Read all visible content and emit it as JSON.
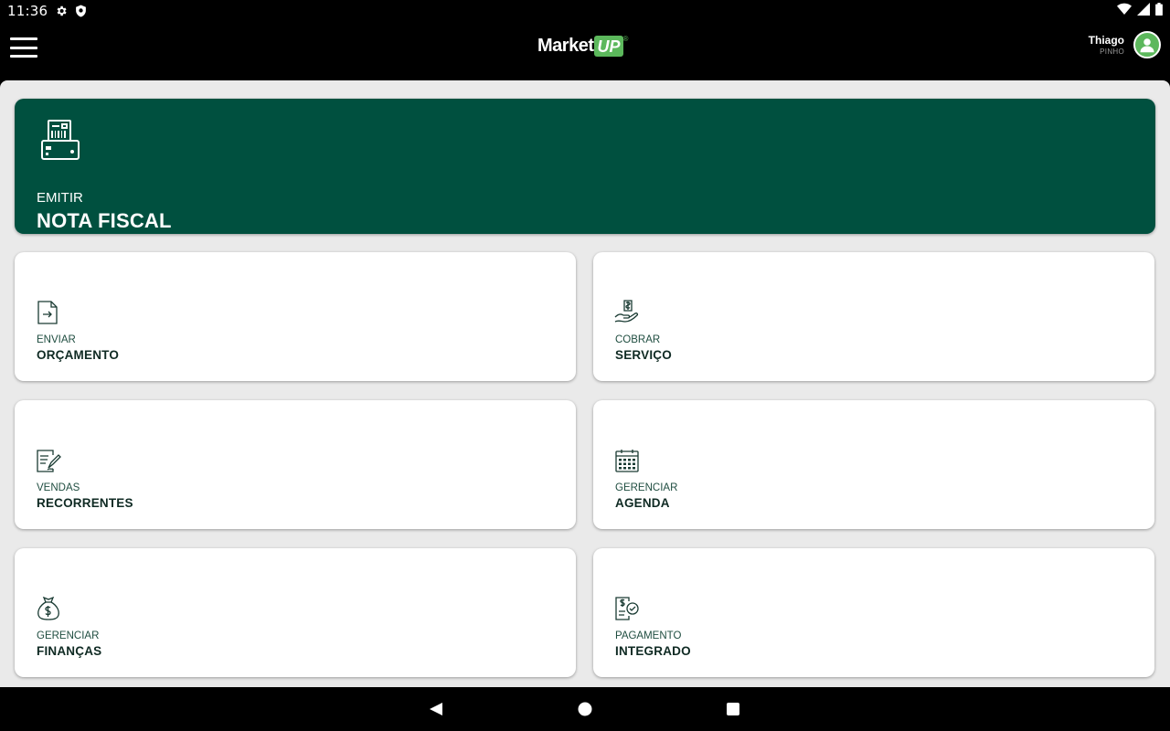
{
  "status_bar": {
    "time": "11:36",
    "left_icons": [
      "settings-icon",
      "shield-icon"
    ],
    "right_icons": [
      "wifi-icon",
      "signal-icon",
      "battery-icon"
    ]
  },
  "app_bar": {
    "logo_text": "Market",
    "logo_badge": "UP",
    "logo_mark": "®",
    "user_name": "Thiago",
    "user_subtitle": "PINHO"
  },
  "hero": {
    "icon": "cash-register-icon",
    "kicker": "EMITIR",
    "title": "NOTA FISCAL"
  },
  "cards": [
    {
      "icon": "document-arrow-icon",
      "kicker": "ENVIAR",
      "title": "ORÇAMENTO"
    },
    {
      "icon": "hand-money-icon",
      "kicker": "COBRAR",
      "title": "SERVIÇO"
    },
    {
      "icon": "document-sign-icon",
      "kicker": "VENDAS",
      "title": "RECORRENTES"
    },
    {
      "icon": "calendar-icon",
      "kicker": "GERENCIAR",
      "title": "AGENDA"
    },
    {
      "icon": "money-bag-icon",
      "kicker": "GERENCIAR",
      "title": "FINANÇAS"
    },
    {
      "icon": "payment-check-icon",
      "kicker": "PAGAMENTO",
      "title": "INTEGRADO"
    }
  ],
  "colors": {
    "accent_dark_green": "#00503f",
    "brand_green": "#5cb85c",
    "background": "#eaeaea",
    "text_dark": "#0f2a23"
  },
  "nav_bar": [
    "back-icon",
    "home-icon",
    "recents-icon"
  ]
}
